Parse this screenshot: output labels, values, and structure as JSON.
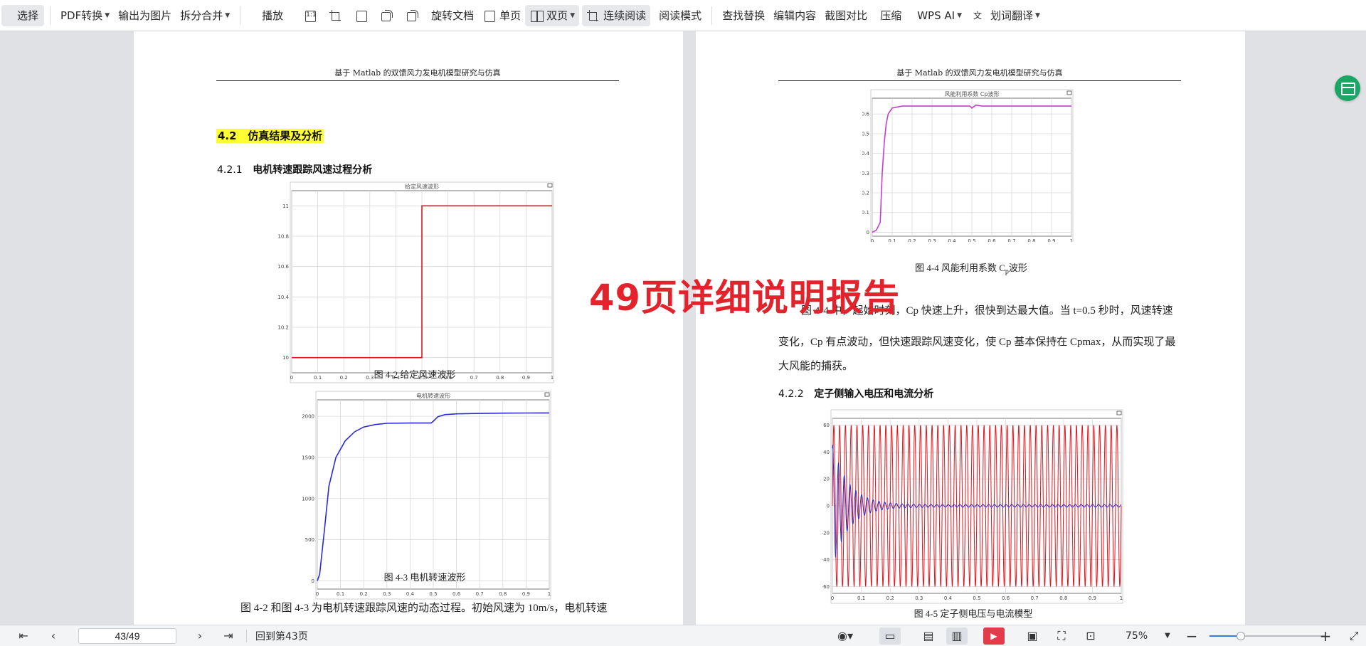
{
  "toolbar": {
    "select": "选择",
    "pdf_convert": "PDF转换",
    "export_image": "输出为图片",
    "split_merge": "拆分合并",
    "play": "播放",
    "actual_size_icon": "1:1",
    "rotate_doc": "旋转文档",
    "single_page": "单页",
    "dual_page": "双页",
    "continuous": "连续阅读",
    "read_mode": "阅读模式",
    "find_replace": "查找替换",
    "edit_content": "编辑内容",
    "screenshot_compare": "截图对比",
    "compress": "压缩",
    "wps_ai": "WPS AI",
    "translate": "划词翻译"
  },
  "left_page": {
    "running_head": "基于 Matlab 的双馈风力发电机模型研究与仿真",
    "section_number": "4.2",
    "section_title": "仿真结果及分析",
    "subsection_number": "4.2.1",
    "subsection_title": "电机转速跟踪风速过程分析",
    "fig2_caption": "图 4-2  给定风速波形",
    "fig3_caption": "图 4-3  电机转速波形",
    "bottom_paragraph": "图 4-2 和图 4-3 为电机转速跟踪风速的动态过程。初始风速为 10m/s，电机转速"
  },
  "right_page": {
    "running_head": "基于 Matlab 的双馈风力发电机模型研究与仿真",
    "fig4_caption_prefix": "图 4-4  风能利用系数 C",
    "fig4_caption_sub": "p",
    "fig4_caption_suffix": "波形",
    "para_line1": "图 4-4 中，起始时刻，Cp 快速上升，很快到达最大值。当 t=0.5 秒时，风速转速",
    "para_line2": "变化，Cp 有点波动，但快速跟踪风速变化，使 Cp 基本保持在 Cpmax，从而实现了最",
    "para_line3": "大风能的捕获。",
    "subsection_number": "4.2.2",
    "subsection_title": "定子侧输入电压和电流分析",
    "fig5_caption": "图 4-5  定子侧电压与电流模型"
  },
  "watermark": "49页详细说明报告",
  "statusbar": {
    "page_value": "43/49",
    "back_to_page": "回到第43页",
    "zoom": "75%",
    "zoom_fraction": 0.27
  },
  "colors": {
    "red_trace": "#e0161e",
    "blue_trace": "#2b2bd6",
    "magenta_trace": "#c23fd0",
    "highlight": "#ffff33",
    "watermark": "#e3232b"
  },
  "chart_data": [
    {
      "id": "fig4-2",
      "type": "line",
      "title": "给定风速波形",
      "x_ticks": [
        "0",
        "0.1",
        "0.2",
        "0.3",
        "0.4",
        "0.5",
        "0.6",
        "0.7",
        "0.8",
        "0.9",
        "1"
      ],
      "y_ticks": [
        "10",
        "10.2",
        "10.4",
        "10.6",
        "10.8",
        "11"
      ],
      "xlim": [
        0,
        1
      ],
      "ylim": [
        9.9,
        11.1
      ],
      "series": [
        {
          "x": [
            0,
            0.5,
            0.5,
            1
          ],
          "y": [
            10,
            10,
            11,
            11
          ]
        }
      ]
    },
    {
      "id": "fig4-3",
      "type": "line",
      "title": "电机转速波形",
      "x_ticks": [
        "0",
        "0.1",
        "0.2",
        "0.3",
        "0.4",
        "0.5",
        "0.6",
        "0.7",
        "0.8",
        "0.9",
        "1"
      ],
      "y_ticks": [
        "0",
        "500",
        "1000",
        "1500",
        "2000"
      ],
      "xlim": [
        0,
        1
      ],
      "ylim": [
        -100,
        2200
      ],
      "series": [
        {
          "x": [
            0,
            0.01,
            0.03,
            0.05,
            0.08,
            0.12,
            0.16,
            0.2,
            0.25,
            0.3,
            0.4,
            0.49,
            0.5,
            0.52,
            0.55,
            0.6,
            0.7,
            0.8,
            0.9,
            1
          ],
          "y": [
            0,
            80,
            600,
            1150,
            1500,
            1700,
            1810,
            1870,
            1900,
            1915,
            1918,
            1918,
            1940,
            1995,
            2020,
            2030,
            2035,
            2038,
            2040,
            2041
          ]
        }
      ]
    },
    {
      "id": "fig4-4",
      "type": "line",
      "title": "风能利用系数 Cp波形",
      "x_ticks": [
        "0",
        "0.1",
        "0.2",
        "0.3",
        "0.4",
        "0.5",
        "0.6",
        "0.7",
        "0.8",
        "0.9",
        "1"
      ],
      "y_ticks": [
        "0",
        "0.1",
        "0.2",
        "0.3",
        "0.4",
        "0.5",
        "0.6"
      ],
      "xlim": [
        0,
        1
      ],
      "ylim": [
        -0.02,
        0.68
      ],
      "series": [
        {
          "x": [
            0,
            0.02,
            0.04,
            0.05,
            0.06,
            0.07,
            0.08,
            0.1,
            0.15,
            0.2,
            0.3,
            0.49,
            0.5,
            0.52,
            0.55,
            0.6,
            0.8,
            1
          ],
          "y": [
            0,
            0.01,
            0.05,
            0.3,
            0.45,
            0.55,
            0.6,
            0.63,
            0.64,
            0.64,
            0.64,
            0.64,
            0.63,
            0.645,
            0.64,
            0.64,
            0.64,
            0.64
          ]
        }
      ]
    },
    {
      "id": "fig4-5",
      "type": "line",
      "title": "",
      "x_ticks": [
        "0",
        "0.1",
        "0.2",
        "0.3",
        "0.4",
        "0.5",
        "0.6",
        "0.7",
        "0.8",
        "0.9",
        "1"
      ],
      "y_ticks": [
        "-60",
        "-40",
        "-20",
        "0",
        "20",
        "40",
        "60"
      ],
      "xlim": [
        0,
        1
      ],
      "ylim": [
        -65,
        65
      ],
      "series": [
        {
          "name": "voltage",
          "kind": "sine",
          "amplitude": 60,
          "frequency_hz": 50
        },
        {
          "name": "current",
          "kind": "damped-sine",
          "amplitude": 45,
          "decay": 18,
          "frequency_hz": 50,
          "steady_amplitude": 1
        }
      ]
    }
  ]
}
